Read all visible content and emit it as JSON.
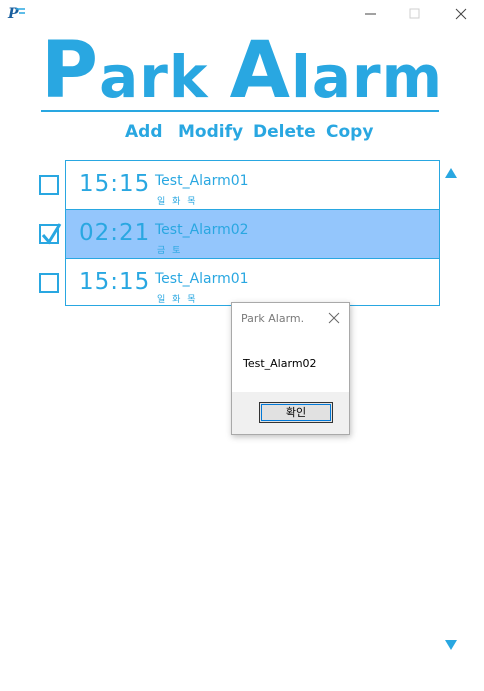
{
  "window": {
    "app_icon": "park-alarm-logo-icon",
    "controls": [
      "minimize-icon",
      "maximize-icon",
      "close-icon"
    ]
  },
  "header": {
    "title_first_letter_1": "P",
    "title_rest_1": "ark",
    "title_first_letter_2": "A",
    "title_rest_2": "larm"
  },
  "toolbar": {
    "add_label": "Add",
    "modify_label": "Modify",
    "delete_label": "Delete",
    "copy_label": "Copy"
  },
  "alarms": [
    {
      "time": "15:15",
      "name": "Test_Alarm01",
      "days": "일 화 목",
      "checked": false,
      "selected": false
    },
    {
      "time": "02:21",
      "name": "Test_Alarm02",
      "days": "금 토",
      "checked": true,
      "selected": true
    },
    {
      "time": "15:15",
      "name": "Test_Alarm01",
      "days": "일 화 목",
      "checked": false,
      "selected": false
    }
  ],
  "dialog": {
    "title": "Park Alarm.",
    "message": "Test_Alarm02",
    "ok_label": "확인"
  },
  "colors": {
    "accent": "#29a7e1",
    "selected_row": "#94c6fc"
  }
}
